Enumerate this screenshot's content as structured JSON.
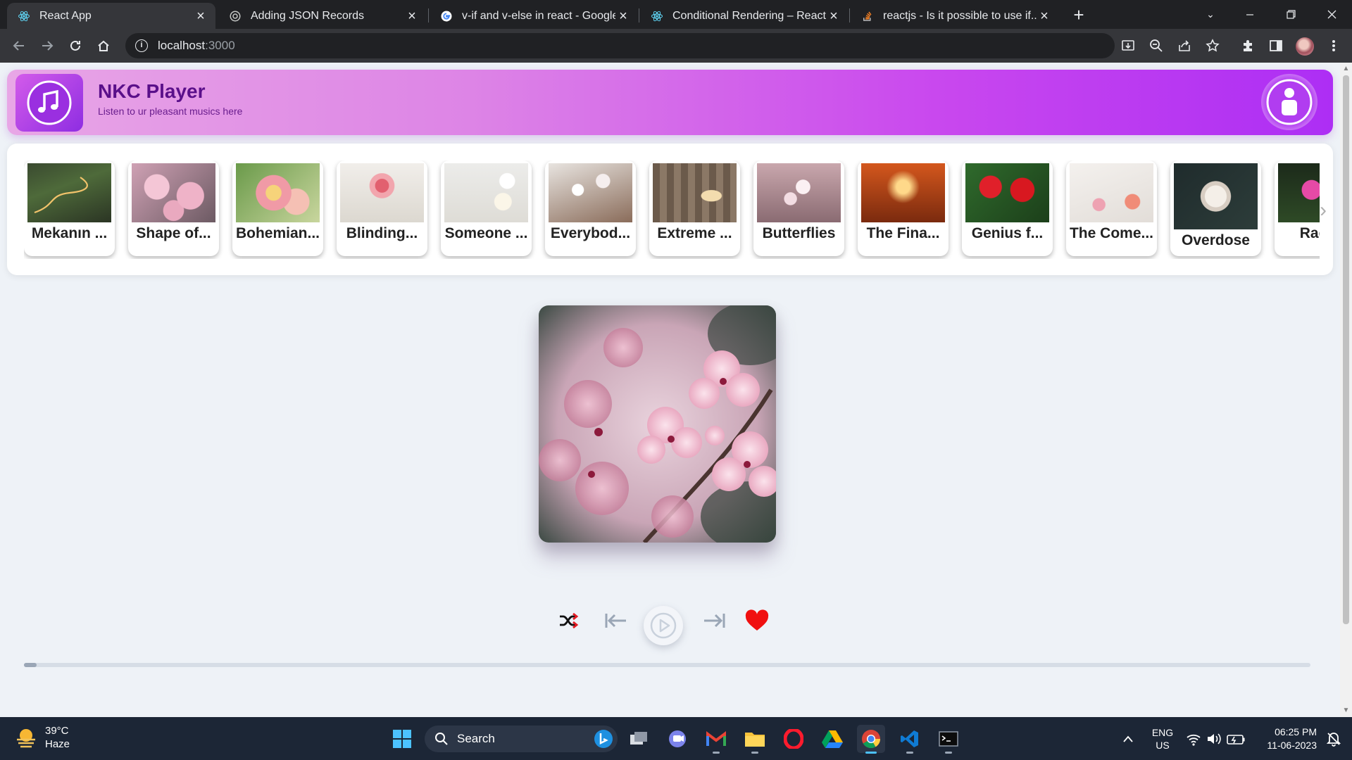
{
  "browser": {
    "tabs": [
      {
        "title": "React App",
        "active": true
      },
      {
        "title": "Adding JSON Records",
        "active": false
      },
      {
        "title": "v-if and v-else in react - Google S",
        "active": false
      },
      {
        "title": "Conditional Rendering – React",
        "active": false
      },
      {
        "title": "reactjs - Is it possible to use if...el",
        "active": false
      }
    ],
    "url_host": "localhost",
    "url_port": ":3000"
  },
  "app": {
    "title": "NKC Player",
    "subtitle": "Listen to ur pleasant musics here",
    "colors": {
      "header_start": "#e8a6e6",
      "header_end": "#ad2ef4",
      "title": "#5a0f8a"
    }
  },
  "songs": [
    {
      "name": "Mekanın ...",
      "thumb": "road-hills"
    },
    {
      "name": "Shape of...",
      "thumb": "pink-blossoms"
    },
    {
      "name": "Bohemian...",
      "thumb": "lily-pink-yellow"
    },
    {
      "name": "Blinding...",
      "thumb": "pink-lily-white"
    },
    {
      "name": "Someone ...",
      "thumb": "white-flowers-pale"
    },
    {
      "name": "Everybod...",
      "thumb": "white-blossom-branch"
    },
    {
      "name": "Extreme ...",
      "thumb": "chick-on-wood"
    },
    {
      "name": "Butterflies",
      "thumb": "blossom-soft"
    },
    {
      "name": "The Fina...",
      "thumb": "orange-glow"
    },
    {
      "name": "Genius f...",
      "thumb": "red-amaryllis"
    },
    {
      "name": "The Come...",
      "thumb": "flatlay-flowers"
    },
    {
      "name": "Overdose",
      "thumb": "white-rose-dark"
    },
    {
      "name": "Rag'n",
      "thumb": "pink-waterlily"
    }
  ],
  "player": {
    "progress": 0.01,
    "liked": true,
    "controls": [
      "shuffle-icon",
      "previous-icon",
      "play-icon",
      "next-icon",
      "heart-icon"
    ]
  },
  "taskbar": {
    "weather_temp": "39°C",
    "weather_desc": "Haze",
    "search_label": "Search",
    "lang_top": "ENG",
    "lang_bottom": "US",
    "time": "06:25 PM",
    "date": "11-06-2023"
  }
}
